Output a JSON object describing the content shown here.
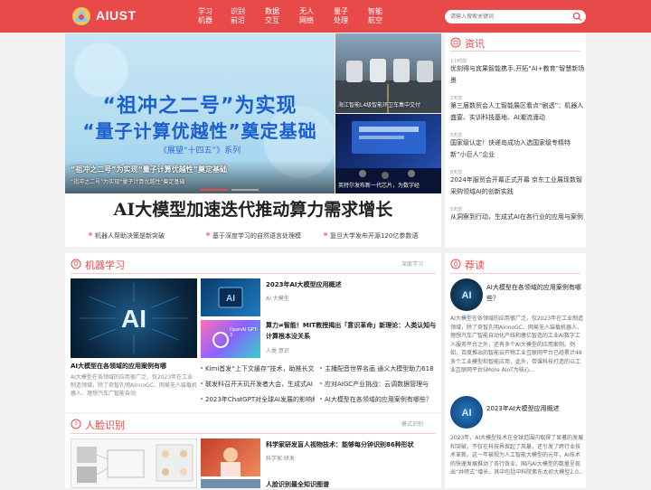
{
  "header": {
    "logo_text": "AIUST",
    "nav": [
      {
        "l1": "学习",
        "l2": "机器"
      },
      {
        "l1": "识别",
        "l2": "前沿"
      },
      {
        "l1": "数据",
        "l2": "交互"
      },
      {
        "l1": "无人",
        "l2": "网络"
      },
      {
        "l1": "量子",
        "l2": "处理"
      },
      {
        "l1": "智能",
        "l2": "航空"
      }
    ],
    "search_placeholder": "请输入搜索关键词"
  },
  "banner": {
    "main_line1": "“祖冲之二号”为实现",
    "main_line2": "“量子计算优越性”奠定基础",
    "main_sub": "《展望“十四五”》系列",
    "main_caption": "“祖冲之二号”为实现“量子计算优越性”奠定基础",
    "main_caption_small": "“祖冲之二号”为实现“量子计算优越性”奠定基础",
    "right1_caption": "海江智能L4级智能环卫车集中交付",
    "right2_caption": "英特尔发布新一代芯片，为数字经"
  },
  "headline": {
    "title": "AI大模型加速迭代推动算力需求增长",
    "ticks": [
      "机器人帮助决策是新突破",
      "基于深度学习的自然语言处理模",
      "复旦大学发布开源120亿参数语"
    ]
  },
  "news": {
    "title": "资讯",
    "items": [
      {
        "date": "1小时前",
        "text": "优刻得与宾果智能携手,开拓“AI+教育”智慧新场景"
      },
      {
        "date": "2天前",
        "text": "第三届数贸会人工智能展区看点“剧透”：机器人盛宴、实训科技基地、AI潮流涌动"
      },
      {
        "date": "5天前",
        "text": "国家级认定！快递岛成功入选国家级专精特新“小巨人”企业"
      },
      {
        "date": "6天前",
        "text": "2024年服贸会开幕正式开幕 京东工业展现数智采购领域AI的创新实践"
      },
      {
        "date": "5天前",
        "text": "从洞察到行动，生成式AI在各行业的应用与案例"
      }
    ]
  },
  "ml": {
    "title": "机器学习",
    "more": "深度学习",
    "feature_title": "AI大模型在各领域的应用案例有哪",
    "feature_desc": "AI大模型在各领域的应用很广泛，仅2023年在工业制造领域，除了奇智孔明AInnoGC、网易无人装载机器人、理想汽车广智能自动",
    "articles": [
      {
        "title": "2023年AI大模型应用概述",
        "meta": "AI 大模型"
      },
      {
        "title": "算力≠智能！MIT教授揭出「意识革命」新理论：人类认知与计算根本没关系",
        "meta": "人类 意识"
      }
    ],
    "list": [
      "Kimi首发“上下文缓存”技术，助推长文",
      "主播配音世界名画 通义大模型助力618",
      "联发科召开天玑开发者大会，生成式AI",
      "应对AIGC产业挑战：云调数据管理与",
      "2023年ChatGPT对全球AI发展的影响和",
      "AI大模型在各领域的应用案例有哪些？"
    ],
    "thumb_label": "OpenAI GPT-3"
  },
  "face": {
    "title": "人脸识别",
    "more": "模式识别",
    "articles": [
      {
        "title": "科学家研发盲人视物技术：能够每分钟识别86种形状",
        "meta": "科学家 研发"
      },
      {
        "title": "人脸识别最全知识图谱",
        "meta": ""
      }
    ]
  },
  "recommend": {
    "title": "荐读",
    "items": [
      {
        "title": "AI大模型在各领域的应用案例有哪些？",
        "desc": "AI大模型在各领域的应用很广泛，仅2023年在工业制造领域，除了奇智孔明AInnoGC、网易无人装载机器人、理想汽车广智能自动化产线和缴亿智造的工业AI数字工人服务平台之外，还有多个AI大模型的应用案例。例如，百度推出的智能云开物工业互联网平台已经累计48多个工业模型和智能应用，此外，带课科技打造的以工业互联网平台SMore AIoT为核心..."
      },
      {
        "title": "2023年AI大模型应用概述",
        "desc": "2023年，AI大模型技术在全球范围内取得了显著的发展和突破，不仅在科技界掀起了风暴，还引发了跨行业技术革新。这一年被视为人工智能大模型的元年，AI技术的快速发展推动了各行各业。国内AI大模型的数量呈现出“井喷式”增长，其中包括中科院紫东太初大模型2.0..."
      }
    ]
  },
  "colors": {
    "brand": "#e84a4a",
    "headline_blue": "#1a5fd1"
  }
}
